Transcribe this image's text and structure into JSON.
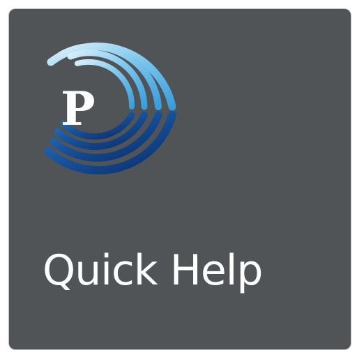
{
  "tile": {
    "label": "Quick Help",
    "background_color": "#505457",
    "label_color": "#ffffff"
  },
  "logo": {
    "letter": "P",
    "icon": "signal-arcs-p-logo-icon",
    "colors": {
      "upper_arcs_light": "#9ed3f1",
      "upper_arcs_mid": "#4aaee3",
      "lower_arcs_mid": "#1f5faa",
      "lower_arcs_dark": "#0b2f6e",
      "letter": "#ffffff"
    }
  }
}
